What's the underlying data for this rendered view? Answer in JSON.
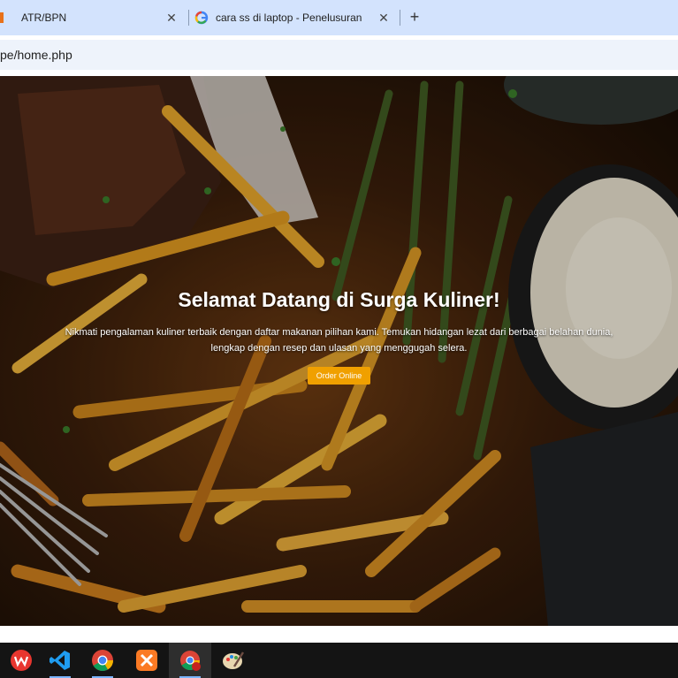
{
  "browser": {
    "tabs": [
      {
        "title": "ATR/BPN",
        "icon": "bookmark-icon"
      },
      {
        "title": "cara ss di laptop - Penelusuran",
        "icon": "google-icon"
      }
    ],
    "close_glyph": "✕",
    "new_tab_glyph": "+",
    "address": "pe/home.php"
  },
  "hero": {
    "title": "Selamat Datang di Surga Kuliner!",
    "description": "Nikmati pengalaman kuliner terbaik dengan daftar makanan pilihan kami. Temukan hidangan lezat dari berbagai belahan dunia, lengkap dengan resep dan ulasan yang menggugah selera.",
    "button_label": "Order Online",
    "accent_color": "#f0a000"
  },
  "taskbar": {
    "apps": [
      {
        "name": "wps-office-icon"
      },
      {
        "name": "vscode-icon"
      },
      {
        "name": "chrome-icon"
      },
      {
        "name": "xampp-icon"
      },
      {
        "name": "chrome-profile-icon",
        "active": true
      },
      {
        "name": "paint-icon"
      }
    ]
  }
}
